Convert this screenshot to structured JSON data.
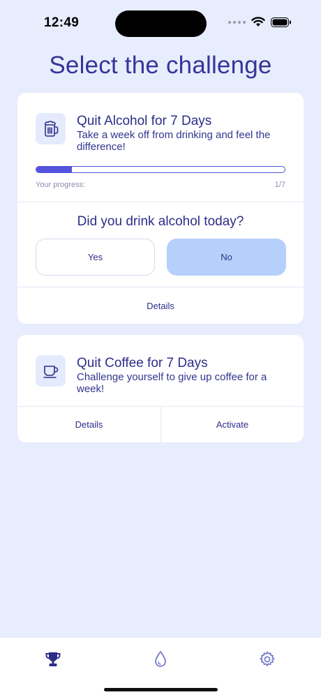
{
  "status_bar": {
    "time": "12:49"
  },
  "page": {
    "title": "Select the challenge"
  },
  "challenges": [
    {
      "icon": "beer-mug-icon",
      "title": "Quit Alcohol for 7 Days",
      "description": "Take a week off from drinking and feel the difference!",
      "progress_label": "Your progress:",
      "progress_count": "1/7",
      "progress_fraction": 0.142857,
      "question": "Did you drink alcohol today?",
      "yes_label": "Yes",
      "no_label": "No",
      "details_label": "Details"
    },
    {
      "icon": "coffee-cup-icon",
      "title": "Quit Coffee for 7 Days",
      "description": "Challenge yourself to give up coffee for a week!",
      "details_label": "Details",
      "activate_label": "Activate"
    }
  ],
  "tab_bar": {
    "tabs": [
      {
        "icon": "trophy-icon",
        "active": true
      },
      {
        "icon": "water-drop-icon",
        "active": false
      },
      {
        "icon": "gear-icon",
        "active": false
      }
    ]
  },
  "colors": {
    "background": "#e8edfd",
    "accent": "#5353dd",
    "selected_button": "#b5d0fa",
    "text": "#2d2e88"
  }
}
